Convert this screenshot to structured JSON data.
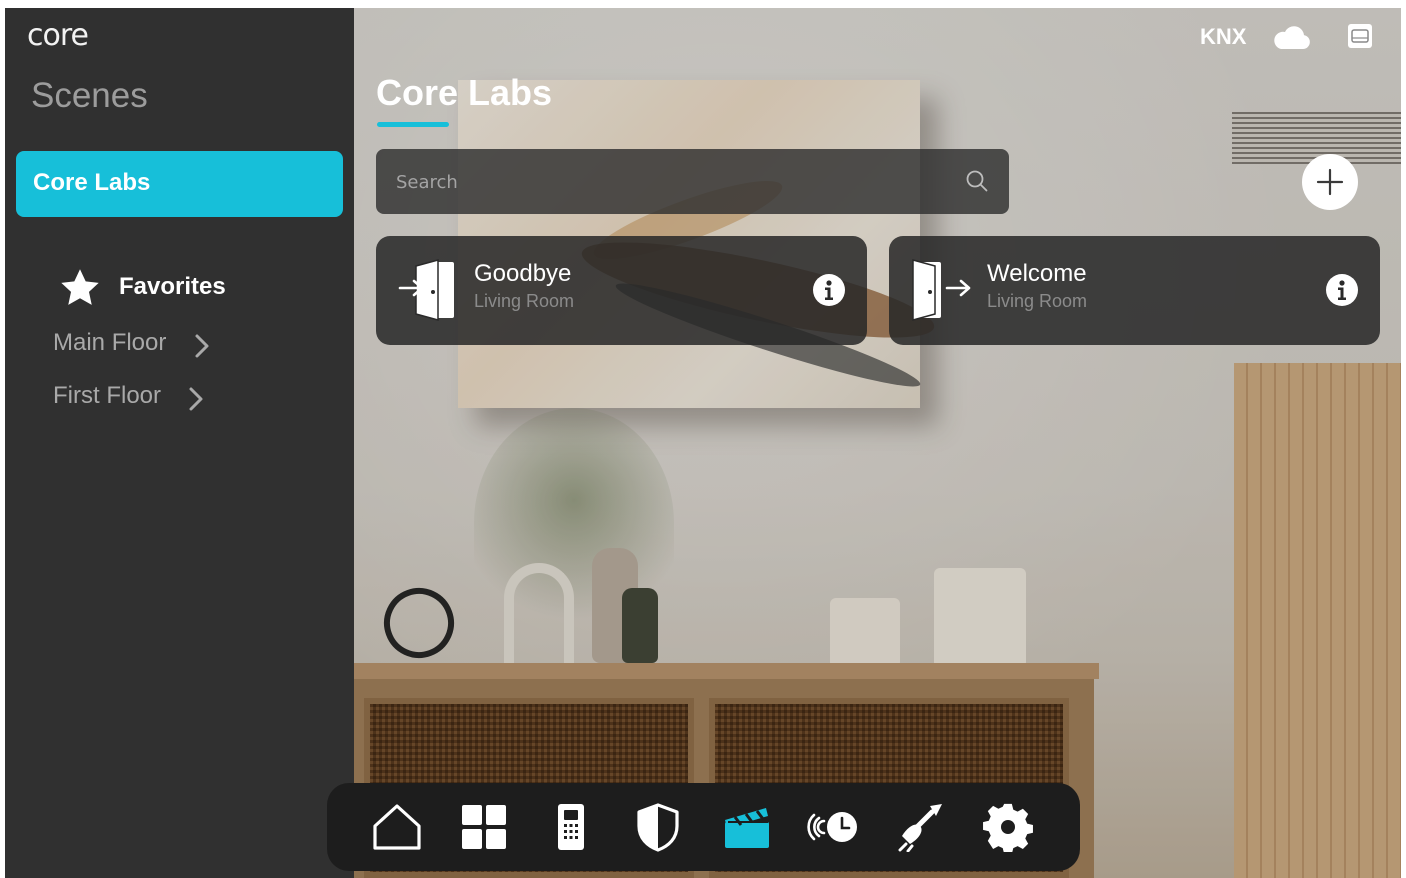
{
  "app": {
    "logo_text": "core"
  },
  "sidebar": {
    "section_title": "Scenes",
    "location": "Core Labs",
    "favorites_label": "Favorites",
    "floors": [
      {
        "label": "Main Floor"
      },
      {
        "label": "First Floor"
      }
    ]
  },
  "header": {
    "title": "Core Labs",
    "knx_label": "KNX",
    "cloud_icon": "cloud-icon",
    "hub_icon": "hub-icon"
  },
  "search": {
    "placeholder": "Search",
    "value": ""
  },
  "scenes": [
    {
      "name": "Goodbye",
      "room": "Living Room",
      "icon": "door-exit-icon"
    },
    {
      "name": "Welcome",
      "room": "Living Room",
      "icon": "door-enter-icon"
    }
  ],
  "bottom_nav": {
    "items": [
      {
        "icon": "home-icon",
        "active": false
      },
      {
        "icon": "grid-icon",
        "active": false
      },
      {
        "icon": "intercom-icon",
        "active": false
      },
      {
        "icon": "security-shield-icon",
        "active": false
      },
      {
        "icon": "scenes-clapper-icon",
        "active": true
      },
      {
        "icon": "schedule-icon",
        "active": false
      },
      {
        "icon": "cleaning-icon",
        "active": false
      },
      {
        "icon": "settings-gear-icon",
        "active": false
      }
    ]
  },
  "colors": {
    "accent": "#17bfd9",
    "sidebar_bg": "#303030",
    "card_bg": "#282828",
    "nav_bg": "#1d1d1d"
  }
}
